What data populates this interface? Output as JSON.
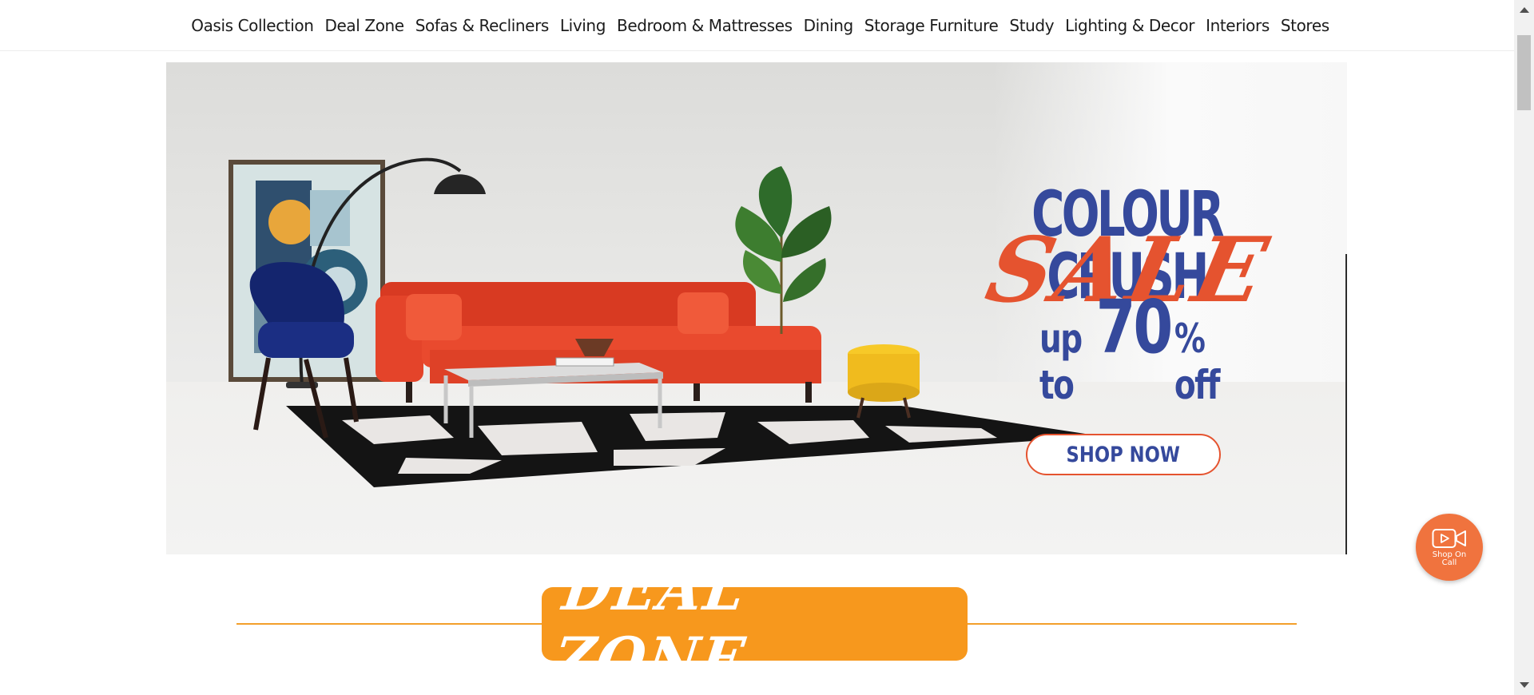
{
  "nav": {
    "items": [
      "Oasis Collection",
      "Deal Zone",
      "Sofas & Recliners",
      "Living",
      "Bedroom & Mattresses",
      "Dining",
      "Storage Furniture",
      "Study",
      "Lighting & Decor",
      "Interiors",
      "Stores"
    ]
  },
  "hero": {
    "headline_line1": "COLOUR CRUSH",
    "headline_line2": "SALE",
    "offer_prefix": "up to",
    "offer_value": "70",
    "offer_suffix": "% off",
    "cta_label": "SHOP NOW",
    "colors": {
      "navy": "#35499c",
      "orange": "#e5532f"
    }
  },
  "section": {
    "title": "DEAL ZONE",
    "colors": {
      "badge": "#f7981d",
      "line": "#f39f2b"
    }
  },
  "shop_on_call": {
    "label": "Shop On Call",
    "icon": "video-camera-icon",
    "color": "#f0733e"
  }
}
